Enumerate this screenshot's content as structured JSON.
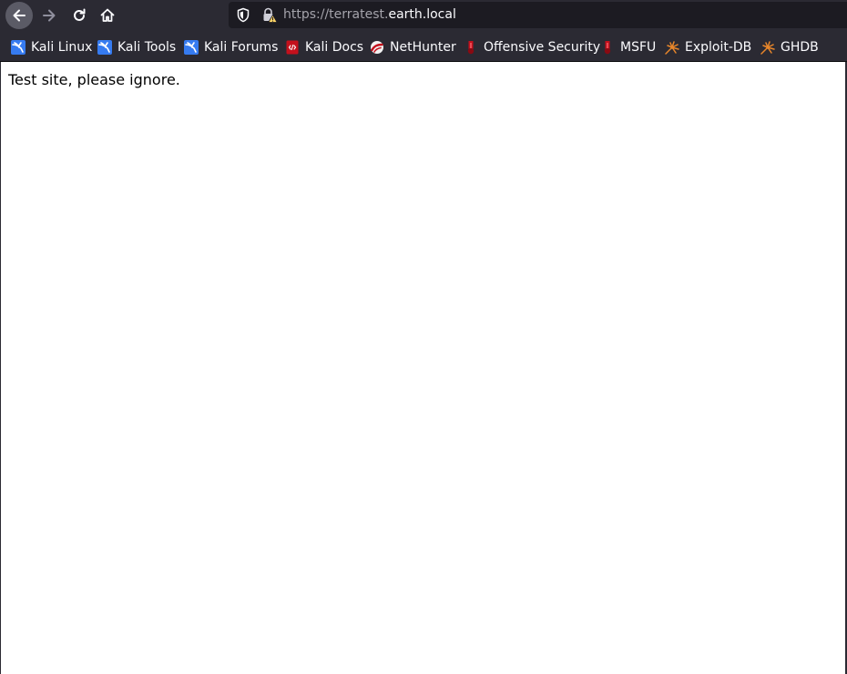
{
  "navigation": {
    "back": "back-arrow-icon",
    "forward": "forward-arrow-icon",
    "reload": "reload-icon",
    "home": "home-icon"
  },
  "url_bar": {
    "prefix": "https://terratest.",
    "domain": "earth.local",
    "shield_icon": "tracking-protection-shield-icon",
    "lock_icon": "insecure-lock-warning-icon"
  },
  "bookmarks": [
    {
      "label": "Kali Linux",
      "icon": "kali-dragon-icon"
    },
    {
      "label": "Kali Tools",
      "icon": "kali-dragon-icon"
    },
    {
      "label": "Kali Forums",
      "icon": "kali-dragon-icon"
    },
    {
      "label": "Kali Docs",
      "icon": "kali-docs-icon"
    },
    {
      "label": "NetHunter",
      "icon": "nethunter-icon"
    },
    {
      "label": "Offensive Security",
      "icon": "offsec-icon"
    },
    {
      "label": "MSFU",
      "icon": "offsec-icon"
    },
    {
      "label": "Exploit-DB",
      "icon": "exploit-db-spider-icon"
    },
    {
      "label": "GHDB",
      "icon": "exploit-db-spider-icon"
    }
  ],
  "page": {
    "text": "Test site, please ignore."
  },
  "colors": {
    "chrome_bg": "#2b2a33",
    "url_bar_bg": "#1c1b22",
    "page_bg": "#ffffff",
    "kali_blue": "#367bf0",
    "offsec_red": "#c4101c",
    "exploitdb_orange": "#e8862a"
  }
}
